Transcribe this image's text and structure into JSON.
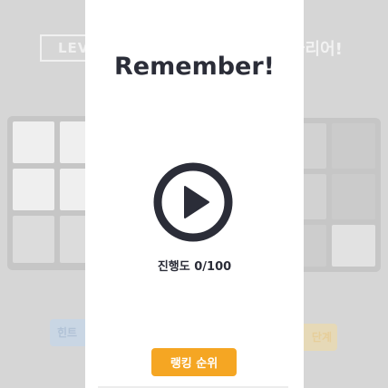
{
  "background": {
    "level_label": "LEVEL",
    "clear_label": "클리어!",
    "hint_label": "힌트",
    "step_label": "단계"
  },
  "modal": {
    "title": "Remember!",
    "progress_text": "진행도 0/100",
    "ranking_button": "랭킹 순위",
    "play_icon": "play-circle-icon"
  },
  "colors": {
    "accent": "#f5a623",
    "dark": "#2b2d38",
    "overlay": "#d6d6d6"
  }
}
